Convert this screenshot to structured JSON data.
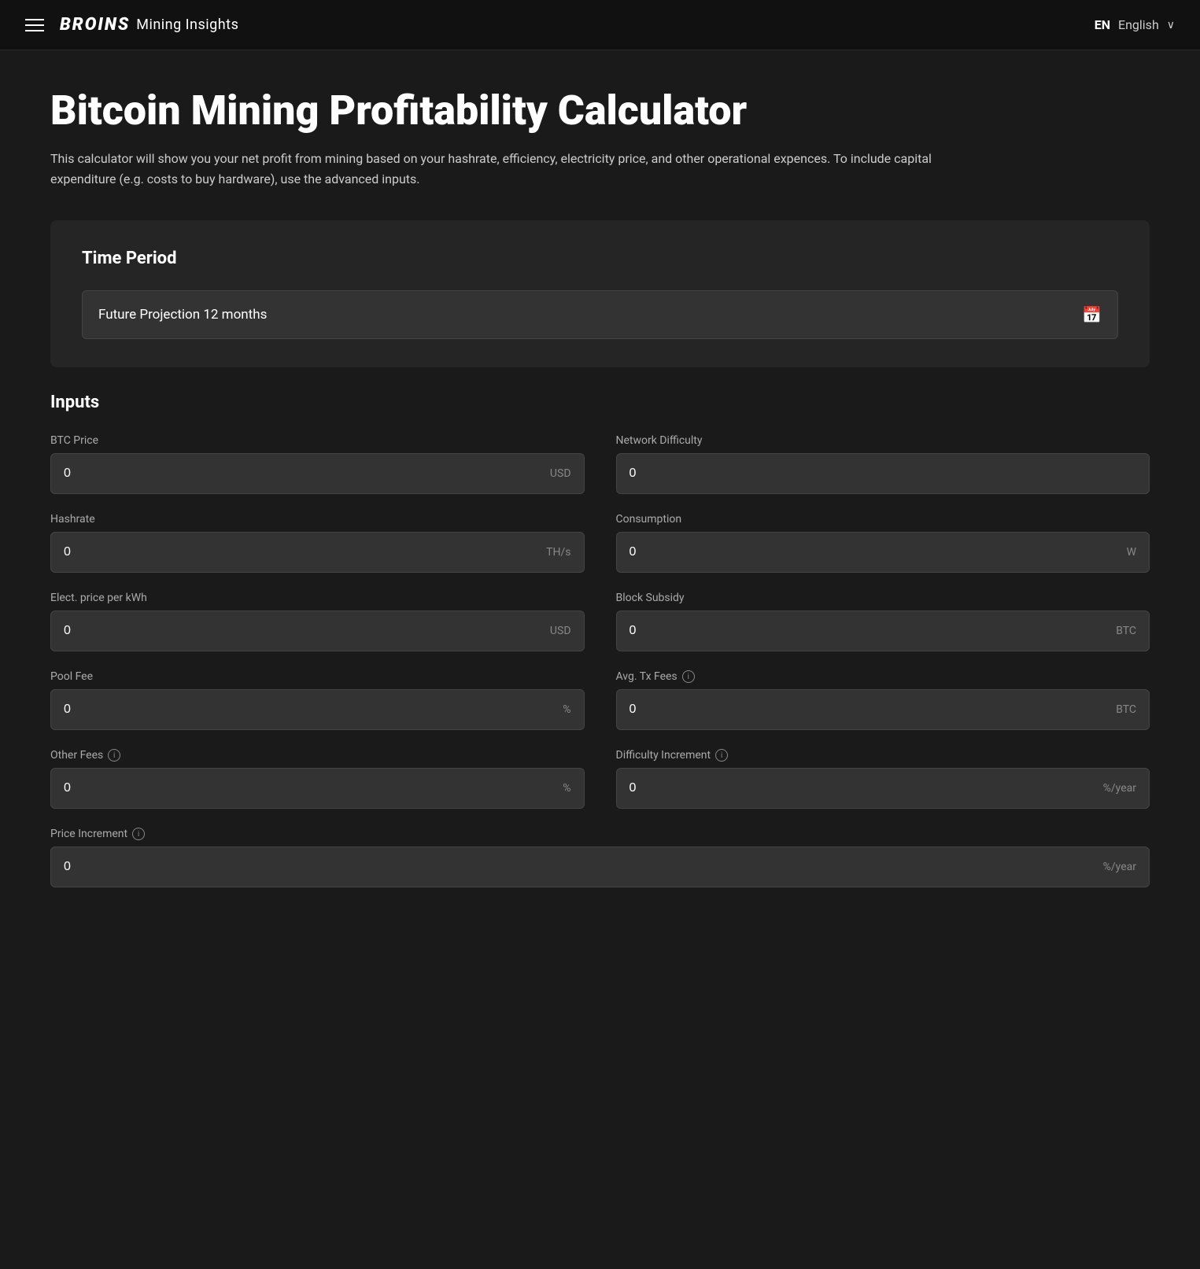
{
  "navbar": {
    "brand_name": "BRΟINS",
    "brand_subtitle": "Mining Insights",
    "lang_code": "EN",
    "lang_label": "English"
  },
  "page": {
    "title": "Bitcoin Mining Profitability Calculator",
    "description": "This calculator will show you your net profit from mining based on your hashrate, efficiency, electricity price, and other operational expences. To include capital expenditure (e.g. costs to buy hardware), use the advanced inputs."
  },
  "time_period": {
    "section_title": "Time Period",
    "selected_value": "Future Projection 12 months"
  },
  "inputs": {
    "section_title": "Inputs",
    "fields": [
      {
        "id": "btc-price",
        "label": "BTC Price",
        "value": "0",
        "unit": "USD",
        "has_info": false,
        "col": "left"
      },
      {
        "id": "network-difficulty",
        "label": "Network Difficulty",
        "value": "0",
        "unit": "",
        "has_info": false,
        "col": "right"
      },
      {
        "id": "hashrate",
        "label": "Hashrate",
        "value": "0",
        "unit": "TH/s",
        "has_info": false,
        "col": "left"
      },
      {
        "id": "consumption",
        "label": "Consumption",
        "value": "0",
        "unit": "W",
        "has_info": false,
        "col": "right"
      },
      {
        "id": "elect-price",
        "label": "Elect. price per kWh",
        "value": "0",
        "unit": "USD",
        "has_info": false,
        "col": "left"
      },
      {
        "id": "block-subsidy",
        "label": "Block Subsidy",
        "value": "0",
        "unit": "BTC",
        "has_info": false,
        "col": "right"
      },
      {
        "id": "pool-fee",
        "label": "Pool Fee",
        "value": "0",
        "unit": "%",
        "has_info": false,
        "col": "left"
      },
      {
        "id": "avg-tx-fees",
        "label": "Avg. Tx Fees",
        "value": "0",
        "unit": "BTC",
        "has_info": true,
        "col": "right"
      },
      {
        "id": "other-fees",
        "label": "Other Fees",
        "value": "0",
        "unit": "%",
        "has_info": true,
        "col": "left"
      },
      {
        "id": "difficulty-increment",
        "label": "Difficulty Increment",
        "value": "0",
        "unit": "%/year",
        "has_info": true,
        "col": "right"
      },
      {
        "id": "price-increment",
        "label": "Price Increment",
        "value": "0",
        "unit": "%/year",
        "has_info": true,
        "col": "full"
      }
    ]
  }
}
